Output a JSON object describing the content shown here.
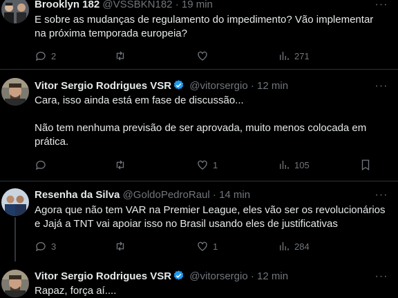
{
  "tweets": [
    {
      "name": "Brooklyn 182",
      "handle": "@VSSBKN182",
      "time": "19 min",
      "verified": false,
      "lines": [
        "E sobre as mudanças de regulamento do impedimento? Vão implementar",
        "na próxima temporada europeia?"
      ],
      "replies": "2",
      "retweets": "",
      "likes": "",
      "views": "271"
    },
    {
      "name": "Vitor Sergio Rodrigues VSR",
      "handle": "@vitorsergio",
      "time": "12 min",
      "verified": true,
      "lines": [
        "Cara, isso ainda está em fase de discussão...",
        "",
        "Não tem nenhuma previsão de ser aprovada, muito menos colocada em",
        "prática."
      ],
      "replies": "",
      "retweets": "",
      "likes": "1",
      "views": "105"
    },
    {
      "name": "Resenha da Silva",
      "handle": "@GoldoPedroRaul",
      "time": "14 min",
      "verified": false,
      "lines": [
        "Agora que não tem VAR na Premier League, eles vão ser os revolucionários",
        "e Jajá a TNT vai apoiar isso no Brasil usando eles de justificativas"
      ],
      "replies": "3",
      "retweets": "",
      "likes": "1",
      "views": "284"
    },
    {
      "name": "Vitor Sergio Rodrigues VSR",
      "handle": "@vitorsergio",
      "time": "12 min",
      "verified": true,
      "lines": [
        "Rapaz, força aí...."
      ],
      "replies": "",
      "retweets": "",
      "likes": "",
      "views": ""
    }
  ],
  "separator": "·",
  "more_glyph": "···",
  "colors": {
    "background": "#000000",
    "text": "#e7e9ea",
    "muted": "#71767b",
    "verified": "#1d9bf0",
    "divider": "#2f3336"
  },
  "icons": [
    "reply-icon",
    "retweet-icon",
    "like-icon",
    "views-icon",
    "bookmark-icon",
    "more-icon",
    "verified-icon"
  ]
}
